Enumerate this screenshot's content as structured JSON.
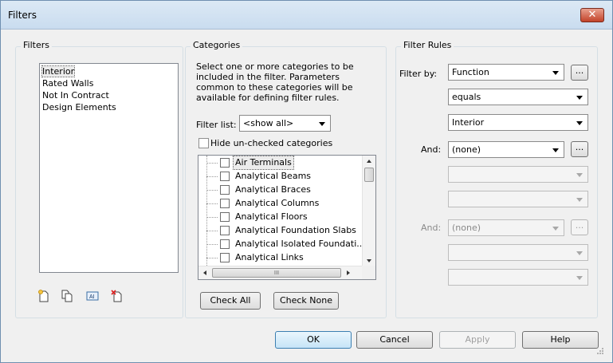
{
  "window": {
    "title": "Filters",
    "close_glyph": "✕"
  },
  "filters_panel": {
    "label": "Filters",
    "items": [
      "Interior",
      "Rated Walls",
      "Not In Contract",
      "Design Elements"
    ],
    "selected_index": 0,
    "toolbar_icons": [
      "new-filter-icon",
      "duplicate-filter-icon",
      "rename-filter-icon",
      "delete-filter-icon"
    ]
  },
  "categories_panel": {
    "label": "Categories",
    "description": "Select one or more categories to be included in the filter.  Parameters common to these categories will be available for defining filter rules.",
    "filter_list_label": "Filter list:",
    "filter_list_value": "<show all>",
    "hide_unchecked_label": "Hide un-checked categories",
    "items": [
      "Air Terminals",
      "Analytical Beams",
      "Analytical Braces",
      "Analytical Columns",
      "Analytical Floors",
      "Analytical Foundation Slabs",
      "Analytical Isolated Foundati..",
      "Analytical Links"
    ],
    "hscroll_grip": "III",
    "check_all_label": "Check All",
    "check_none_label": "Check None"
  },
  "filter_rules_panel": {
    "label": "Filter Rules",
    "filter_by_label": "Filter by:",
    "rule1": {
      "parameter": "Function",
      "operator": "equals",
      "value": "Interior"
    },
    "and_label_1": "And:",
    "rule2": {
      "parameter": "(none)"
    },
    "and_label_2": "And:",
    "rule3": {
      "parameter": "(none)"
    },
    "browse_label": "..."
  },
  "buttons": {
    "ok": "OK",
    "cancel": "Cancel",
    "apply": "Apply",
    "help": "Help"
  }
}
